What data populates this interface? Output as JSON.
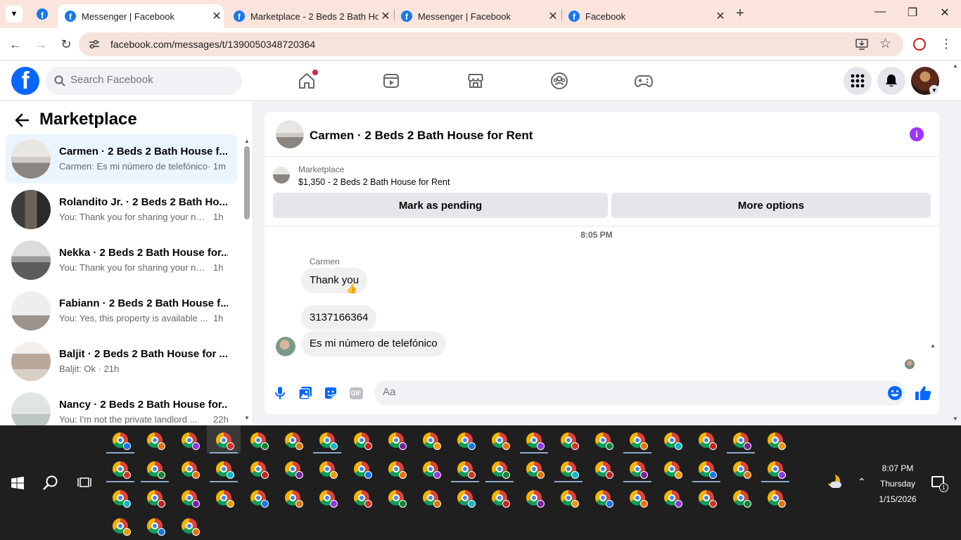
{
  "browser": {
    "tabs": [
      {
        "title": "Messenger | Facebook",
        "active": true
      },
      {
        "title": "Marketplace - 2 Beds 2 Bath Ho",
        "active": false
      },
      {
        "title": "Messenger | Facebook",
        "active": false
      },
      {
        "title": "Facebook",
        "active": false
      }
    ],
    "url": "facebook.com/messages/t/1390050348720364"
  },
  "fb": {
    "search_placeholder": "Search Facebook",
    "logo_letter": "f"
  },
  "left_panel": {
    "title": "Marketplace",
    "conversations": [
      {
        "name": "Carmen · 2 Beds 2 Bath House f...",
        "snippet": "Carmen: Es mi número de telefónico",
        "time": "· 1m",
        "selected": true
      },
      {
        "name": "Rolandito Jr. · 2 Beds 2 Bath Ho...",
        "snippet": "You: Thank you for sharing your nu...",
        "time": "1h"
      },
      {
        "name": "Nekka · 2 Beds 2 Bath House for...",
        "snippet": "You: Thank you for sharing your nu...",
        "time": "1h"
      },
      {
        "name": "Fabiann · 2 Beds 2 Bath House f...",
        "snippet": "You: Yes, this property is available ...",
        "time": "1h"
      },
      {
        "name": "Baljit · 2 Beds 2 Bath House for ...",
        "snippet": "Baljit: Ok · 21h",
        "time": ""
      },
      {
        "name": "Nancy · 2 Beds 2 Bath House for...",
        "snippet": "You: I'm not the private landlord ...",
        "time": "22h"
      }
    ]
  },
  "chat": {
    "title": "Carmen · 2 Beds 2 Bath House for Rent",
    "marketplace_label": "Marketplace",
    "listing": "$1,350 - 2 Beds 2 Bath House for Rent",
    "mark_pending": "Mark as pending",
    "more_options": "More options",
    "timestamp": "8:05 PM",
    "sender": "Carmen",
    "messages": [
      "Thank you",
      "3137166364",
      "Es mi número de telefónico"
    ],
    "reaction": "👍",
    "composer_placeholder": "Aa",
    "gif_label": "GIF"
  },
  "taskbar": {
    "time": "8:07 PM",
    "day": "Thursday",
    "date": "1/15/2026",
    "notification_count": "1"
  }
}
